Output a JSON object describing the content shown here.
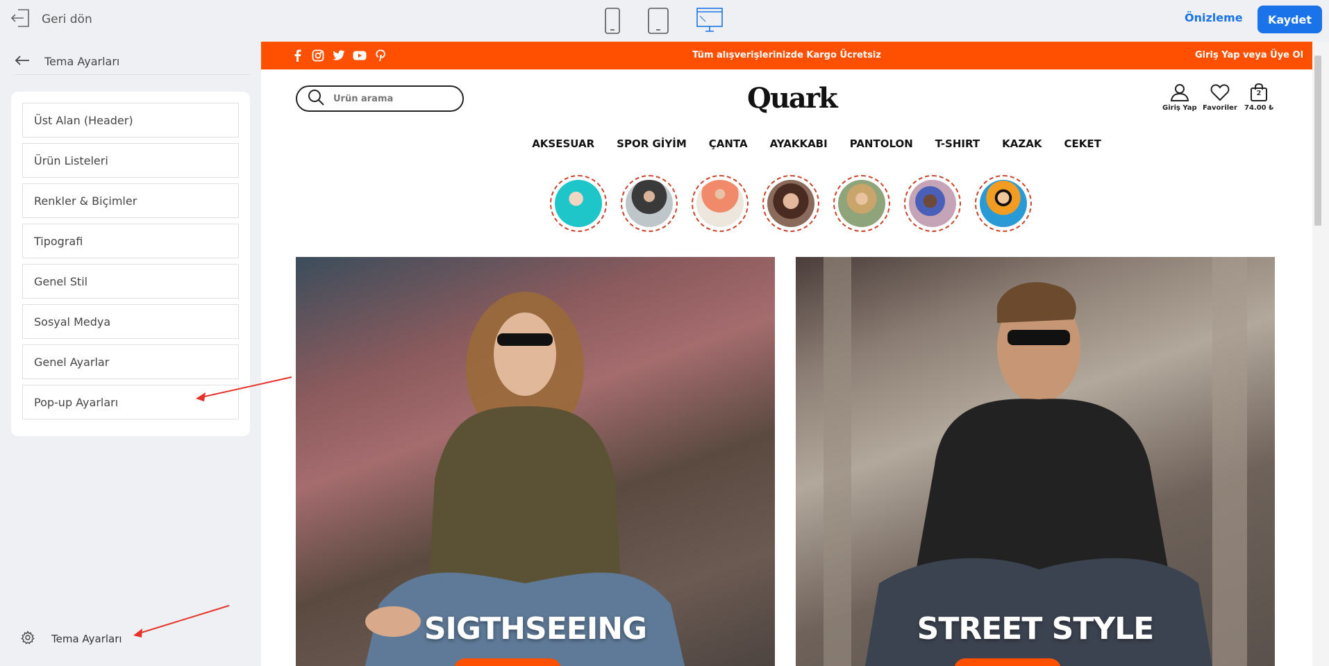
{
  "topbar": {
    "back_label": "Geri dön",
    "preview_label": "Önizleme",
    "save_label": "Kaydet"
  },
  "sidebar": {
    "header_title": "Tema Ayarları",
    "items": [
      {
        "label": "Üst Alan (Header)"
      },
      {
        "label": "Ürün Listeleri"
      },
      {
        "label": "Renkler & Biçimler"
      },
      {
        "label": "Tipografi"
      },
      {
        "label": "Genel Stil"
      },
      {
        "label": "Sosyal Medya"
      },
      {
        "label": "Genel Ayarlar"
      },
      {
        "label": "Pop-up Ayarları"
      }
    ],
    "footer_label": "Tema Ayarları"
  },
  "store": {
    "promo_message": "Tüm alışverişlerinizde Kargo Ücretsiz",
    "login_link": "Giriş Yap veya Üye Ol",
    "search_placeholder": "Ürün arama",
    "logo": "Quark",
    "account_label": "Giriş Yap",
    "favorites_label": "Favoriler",
    "cart_count": "2",
    "cart_total": "74.00 ₺",
    "nav": [
      "AKSESUAR",
      "SPOR GİYİM",
      "ÇANTA",
      "AYAKKABI",
      "PANTOLON",
      "T-SHIRT",
      "KAZAK",
      "CEKET"
    ],
    "banners": [
      {
        "title": "SIGTHSEEING"
      },
      {
        "title": "STREET STYLE"
      }
    ]
  },
  "colors": {
    "accent": "#1a73e8",
    "brand_orange": "#fe5000",
    "annotation_arrow": "#e5332a"
  }
}
